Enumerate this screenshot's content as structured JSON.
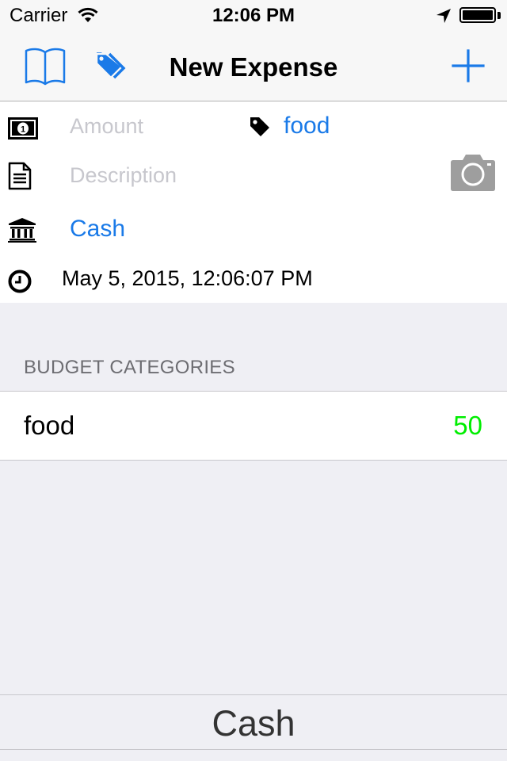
{
  "status_bar": {
    "carrier": "Carrier",
    "time": "12:06 PM"
  },
  "nav": {
    "title": "New Expense",
    "left_icon": "book-icon",
    "second_icon": "tags-icon",
    "right_icon": "plus-icon"
  },
  "form": {
    "amount_placeholder": "Amount",
    "category": "food",
    "description_placeholder": "Description",
    "account": "Cash",
    "datetime": "May 5, 2015, 12:06:07 PM"
  },
  "budget": {
    "header": "BUDGET CATEGORIES",
    "items": [
      {
        "name": "food",
        "value": "50"
      }
    ]
  },
  "bottom_bar": {
    "label": "Cash"
  },
  "colors": {
    "accent": "#1a7ae8",
    "budget_value": "#00ee00",
    "placeholder": "#c7c7cd",
    "background": "#efeff4"
  }
}
